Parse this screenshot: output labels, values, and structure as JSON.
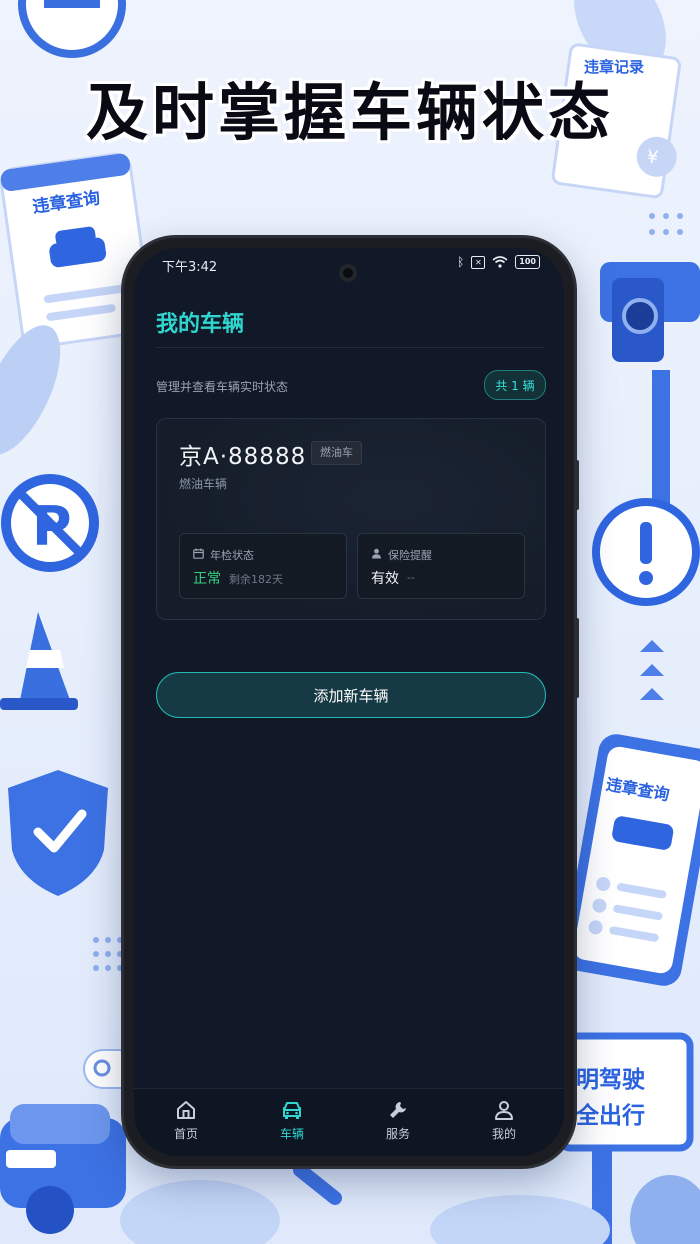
{
  "headline": "及时掌握车辆状态",
  "stickers": {
    "violation_query": "违章查询",
    "violation_record": "违章记录",
    "phone_sticker": "违章查询",
    "billboard_line1": "明驾驶",
    "billboard_line2": "全出行"
  },
  "colors": {
    "accent": "#2fd6d0",
    "screen_bg": "#111827",
    "status_ok": "#35d07f",
    "brand_blue": "#2a62e0"
  },
  "status_bar": {
    "time": "下午3:42",
    "battery": "100"
  },
  "page": {
    "title": "我的车辆",
    "subtitle": "管理并查看车辆实时状态",
    "count_badge": "共 1 辆"
  },
  "vehicle": {
    "plate": "京A·88888",
    "fuel_tag": "燃油车",
    "fuel_desc": "燃油车辆",
    "inspection": {
      "label": "年检状态",
      "value": "正常",
      "extra": "剩余182天",
      "icon": "calendar-icon"
    },
    "insurance": {
      "label": "保险提醒",
      "value": "有效",
      "extra": "--",
      "icon": "person-icon"
    }
  },
  "add_button": "添加新车辆",
  "tabs": [
    {
      "label": "首页",
      "icon": "home-icon"
    },
    {
      "label": "车辆",
      "icon": "car-icon"
    },
    {
      "label": "服务",
      "icon": "wrench-icon"
    },
    {
      "label": "我的",
      "icon": "user-icon"
    }
  ]
}
